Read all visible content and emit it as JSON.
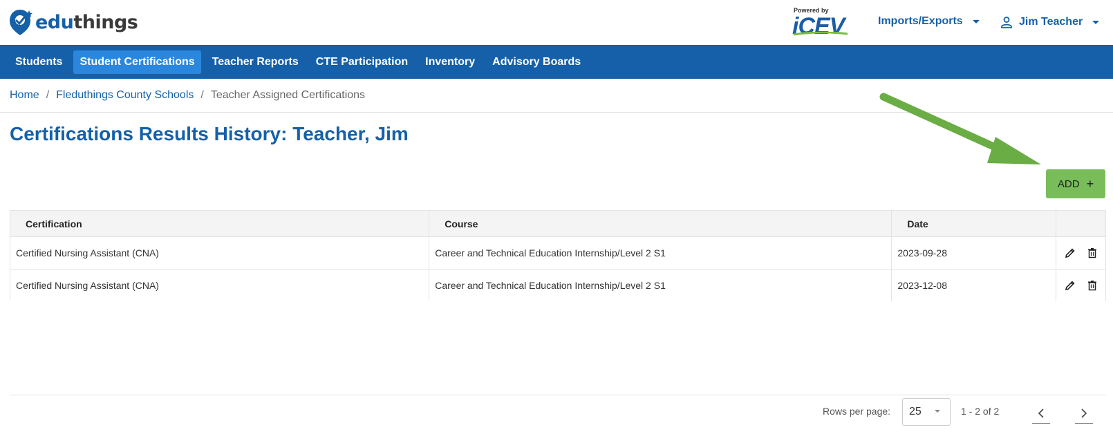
{
  "header": {
    "logo": {
      "part1": "edu",
      "part2": "things"
    },
    "icev": {
      "powered": "Powered by",
      "brand": "iCEV"
    },
    "imports_menu": "Imports/Exports",
    "user_menu": "Jim Teacher"
  },
  "nav": {
    "items": [
      {
        "label": "Students",
        "active": false
      },
      {
        "label": "Student Certifications",
        "active": true
      },
      {
        "label": "Teacher Reports",
        "active": false
      },
      {
        "label": "CTE Participation",
        "active": false
      },
      {
        "label": "Inventory",
        "active": false
      },
      {
        "label": "Advisory Boards",
        "active": false
      }
    ]
  },
  "breadcrumb": {
    "home": "Home",
    "district": "Fleduthings County Schools",
    "current": "Teacher Assigned Certifications",
    "separator": "/"
  },
  "page": {
    "title": "Certifications Results History: Teacher, Jim",
    "add_label": "ADD",
    "add_icon": "+"
  },
  "table": {
    "headers": {
      "certification": "Certification",
      "course": "Course",
      "date": "Date"
    },
    "rows": [
      {
        "certification": "Certified Nursing Assistant (CNA)",
        "course": "Career and Technical Education Internship/Level 2 S1",
        "date": "2023-09-28"
      },
      {
        "certification": "Certified Nursing Assistant (CNA)",
        "course": "Career and Technical Education Internship/Level 2 S1",
        "date": "2023-12-08"
      }
    ]
  },
  "pagination": {
    "rows_per_page_label": "Rows per page:",
    "rows_per_page_value": "25",
    "range": "1 - 2 of 2"
  },
  "colors": {
    "brand_blue": "#1560a8",
    "nav_active": "#2b87dd",
    "add_green": "#79bd5b",
    "annotation_arrow": "#6aad45"
  },
  "icons": [
    "user-icon",
    "caret-down-icon",
    "edit-icon",
    "delete-icon",
    "chevron-left-icon",
    "chevron-right-icon",
    "plus-icon"
  ]
}
